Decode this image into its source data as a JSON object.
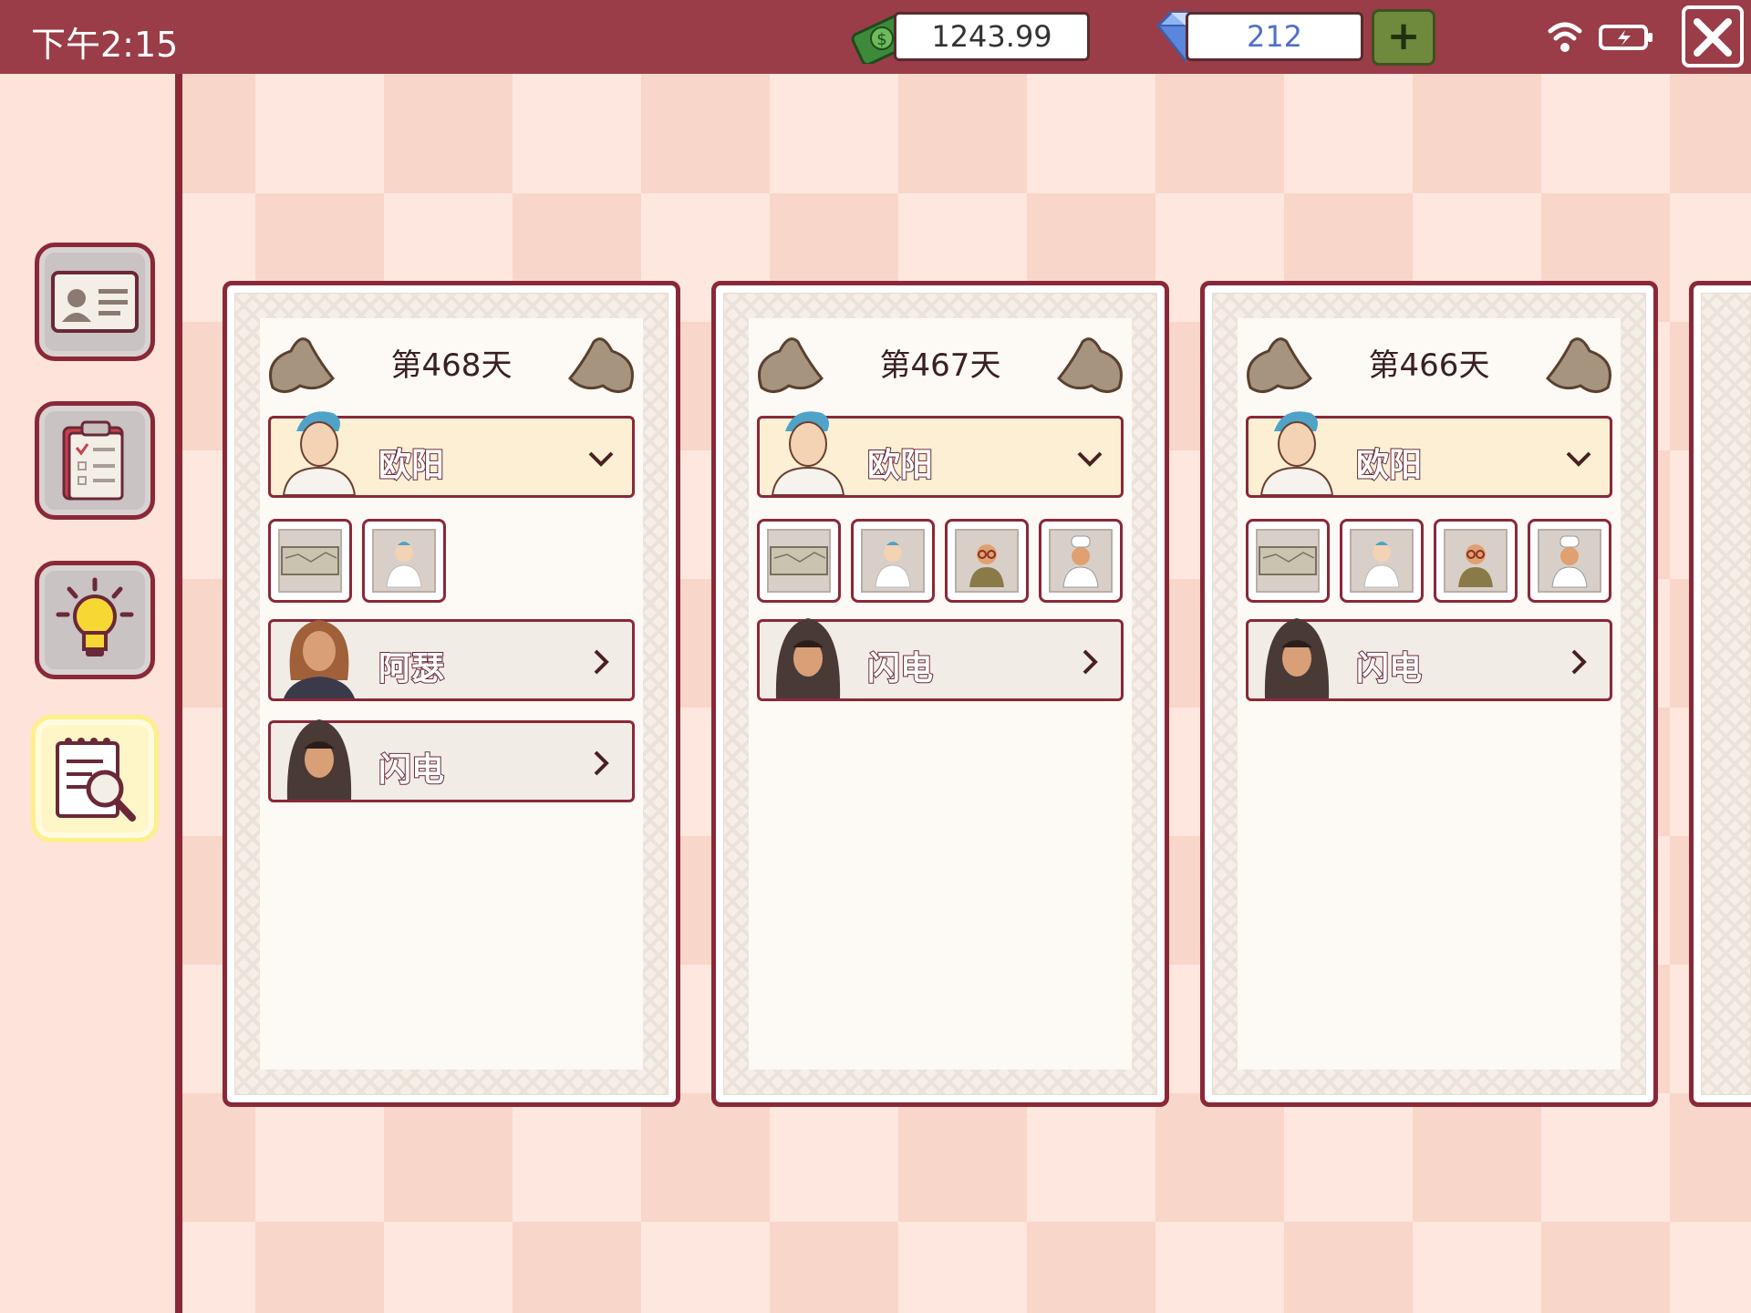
{
  "status_bar": {
    "time": "下午2:15"
  },
  "resources": {
    "money": "1243.99",
    "gems": "212",
    "add_label": "+"
  },
  "sidebar": {
    "items": [
      {
        "icon": "id-card-icon"
      },
      {
        "icon": "clipboard-icon"
      },
      {
        "icon": "lightbulb-icon"
      },
      {
        "icon": "notepad-search-icon"
      }
    ]
  },
  "days": [
    {
      "title": "第468天",
      "selected": {
        "name": "欧阳"
      },
      "thumbs": [
        "map-thumbnail",
        "doctor-portrait"
      ],
      "suspects": [
        {
          "name": "阿瑟"
        },
        {
          "name": "闪电"
        }
      ]
    },
    {
      "title": "第467天",
      "selected": {
        "name": "欧阳"
      },
      "thumbs": [
        "map-thumbnail",
        "doctor-portrait",
        "old-man-portrait",
        "chef-portrait"
      ],
      "suspects": [
        {
          "name": "闪电"
        }
      ]
    },
    {
      "title": "第466天",
      "selected": {
        "name": "欧阳"
      },
      "thumbs": [
        "map-thumbnail",
        "doctor-portrait",
        "old-man-portrait",
        "chef-portrait"
      ],
      "suspects": [
        {
          "name": "闪电"
        }
      ]
    }
  ],
  "colors": {
    "topbar": "#9a3d48",
    "border": "#8a2838",
    "highlight": "#fcefd3",
    "active_tab": "#fdef8a"
  }
}
